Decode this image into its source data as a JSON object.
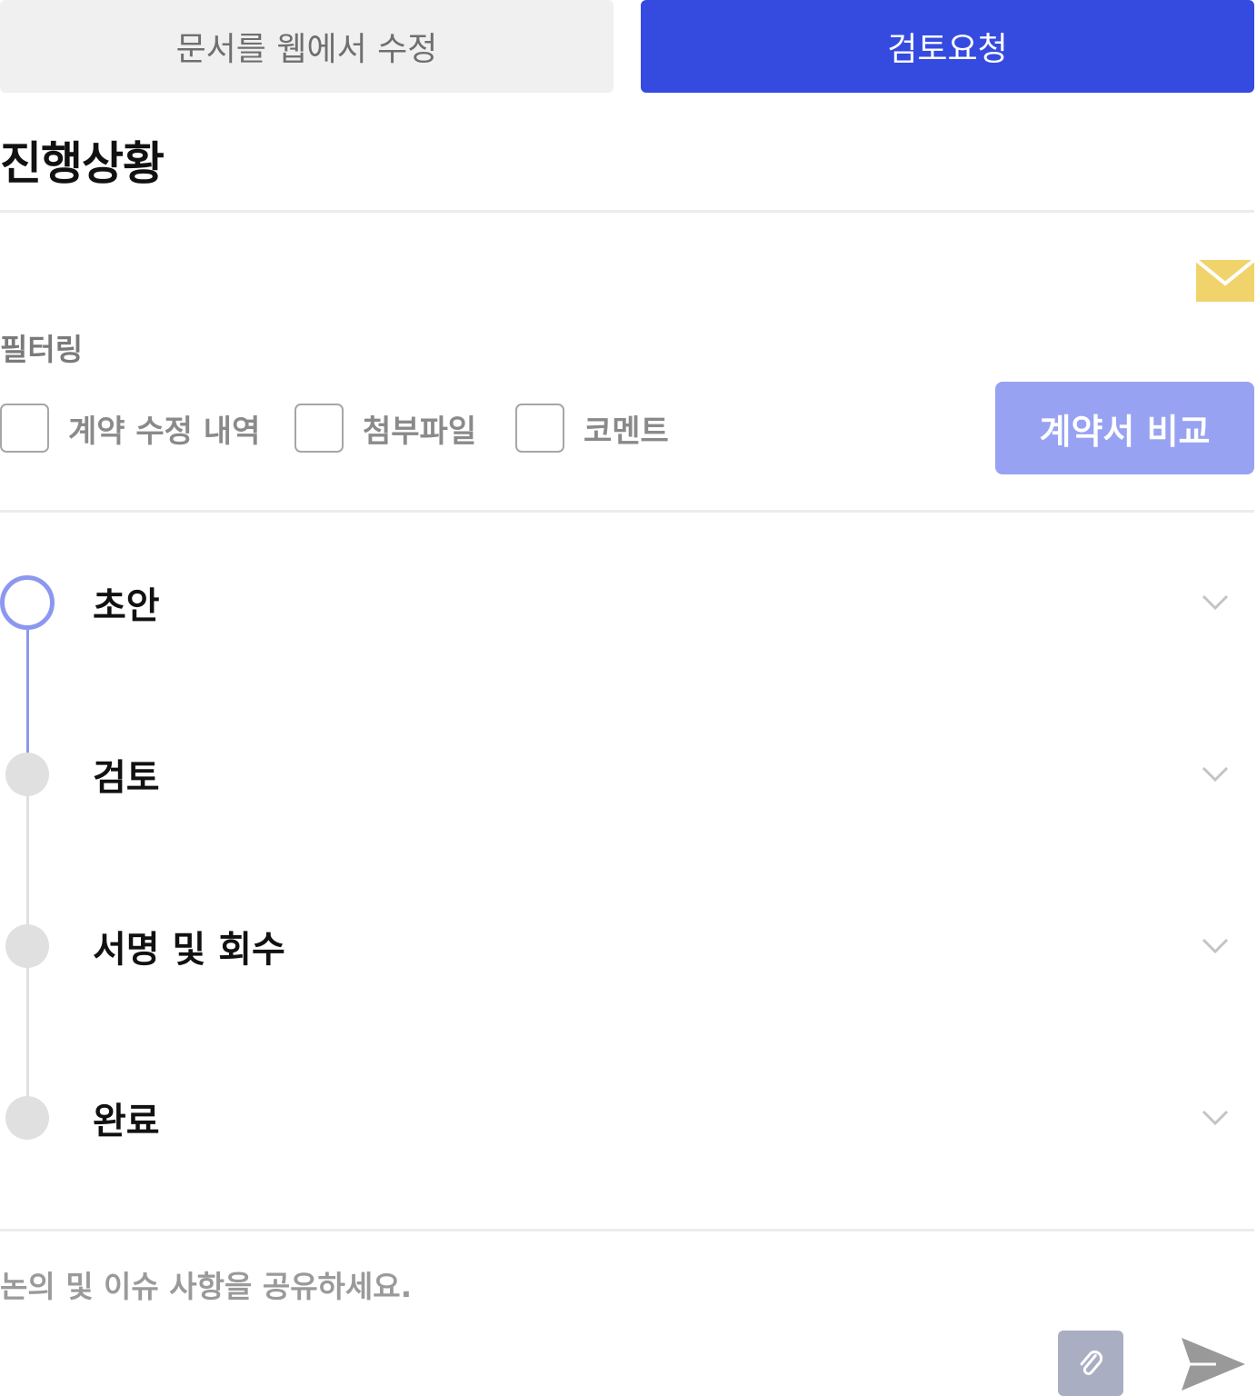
{
  "toolbar": {
    "edit_web_label": "문서를 웹에서 수정",
    "review_request_label": "검토요청"
  },
  "progress": {
    "title": "진행상황"
  },
  "filter": {
    "label": "필터링",
    "options": [
      {
        "label": "계약 수정 내역",
        "checked": false
      },
      {
        "label": "첨부파일",
        "checked": false
      },
      {
        "label": "코멘트",
        "checked": false
      }
    ],
    "compare_label": "계약서 비교"
  },
  "steps": [
    {
      "label": "초안",
      "state": "active"
    },
    {
      "label": "검토",
      "state": "pending"
    },
    {
      "label": "서명 및 회수",
      "state": "pending"
    },
    {
      "label": "완료",
      "state": "pending"
    }
  ],
  "comment": {
    "placeholder": "논의 및 이슈 사항을 공유하세요."
  },
  "colors": {
    "primary": "#354be0",
    "primary_light": "#98a2f2",
    "timeline_active": "#8c98ef",
    "timeline_inactive": "#e0e0e0",
    "mail_icon": "#f0d36b",
    "attach_bg": "#a9aec3",
    "send_icon": "#999999"
  },
  "icons": {
    "mail": "mail-icon",
    "chevron": "chevron-down-icon",
    "attach": "paperclip-icon",
    "send": "send-icon"
  }
}
